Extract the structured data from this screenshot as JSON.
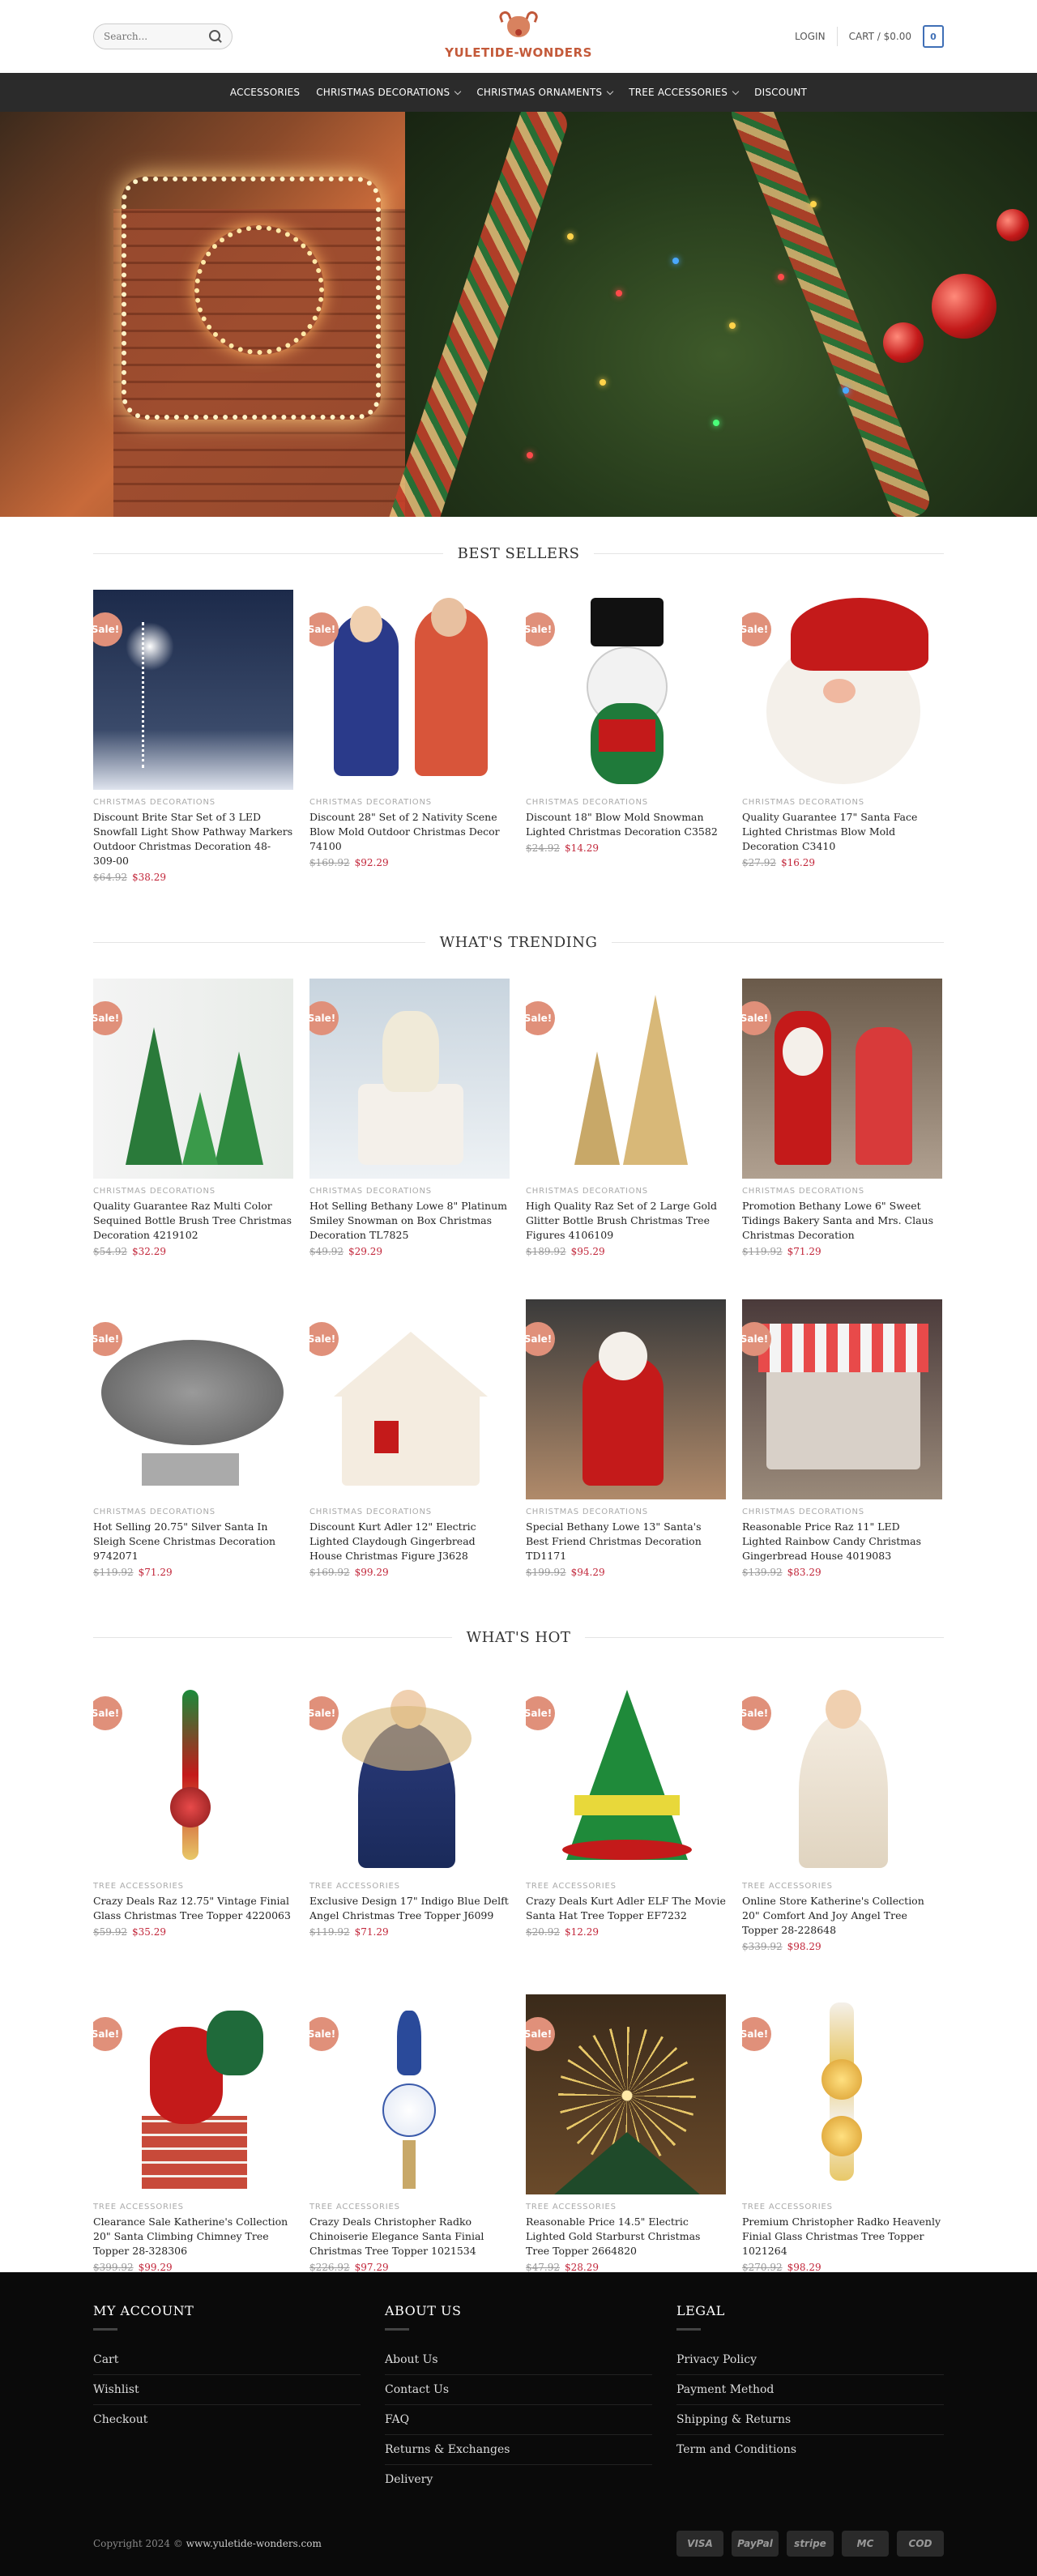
{
  "header": {
    "search_placeholder": "Search...",
    "logo_text": "YULETIDE-WONDERS",
    "login": "LOGIN",
    "cart_label": "CART / $0.00",
    "cart_count": "0"
  },
  "nav": {
    "items": [
      {
        "label": "ACCESSORIES",
        "dropdown": false
      },
      {
        "label": "CHRISTMAS DECORATIONS",
        "dropdown": true
      },
      {
        "label": "CHRISTMAS ORNAMENTS",
        "dropdown": true
      },
      {
        "label": "TREE ACCESSORIES",
        "dropdown": true
      },
      {
        "label": "DISCOUNT",
        "dropdown": false
      }
    ]
  },
  "sale_badge": "Sale!",
  "sections": [
    {
      "title": "BEST SELLERS",
      "products": [
        {
          "category": "CHRISTMAS DECORATIONS",
          "name": "Discount Brite Star Set of 3 LED Snowfall Light Show Pathway Markers Outdoor Christmas Decoration 48-309-00",
          "old": "$64.92",
          "new": "$38.29"
        },
        {
          "category": "CHRISTMAS DECORATIONS",
          "name": "Discount 28\" Set of 2 Nativity Scene Blow Mold Outdoor Christmas Decor 74100",
          "old": "$169.92",
          "new": "$92.29"
        },
        {
          "category": "CHRISTMAS DECORATIONS",
          "name": "Discount 18\" Blow Mold Snowman Lighted Christmas Decoration C3582",
          "old": "$24.92",
          "new": "$14.29"
        },
        {
          "category": "CHRISTMAS DECORATIONS",
          "name": "Quality Guarantee 17\" Santa Face Lighted Christmas Blow Mold Decoration C3410",
          "old": "$27.92",
          "new": "$16.29"
        }
      ]
    },
    {
      "title": "WHAT'S TRENDING",
      "products": [
        {
          "category": "CHRISTMAS DECORATIONS",
          "name": "Quality Guarantee Raz Multi Color Sequined Bottle Brush Tree Christmas Decoration 4219102",
          "old": "$54.92",
          "new": "$32.29"
        },
        {
          "category": "CHRISTMAS DECORATIONS",
          "name": "Hot Selling Bethany Lowe 8\" Platinum Smiley Snowman on Box Christmas Decoration TL7825",
          "old": "$49.92",
          "new": "$29.29"
        },
        {
          "category": "CHRISTMAS DECORATIONS",
          "name": "High Quality Raz Set of 2 Large Gold Glitter Bottle Brush Christmas Tree Figures 4106109",
          "old": "$189.92",
          "new": "$95.29"
        },
        {
          "category": "CHRISTMAS DECORATIONS",
          "name": "Promotion Bethany Lowe 6\" Sweet Tidings Bakery Santa and Mrs. Claus Christmas Decoration",
          "old": "$119.92",
          "new": "$71.29"
        },
        {
          "category": "CHRISTMAS DECORATIONS",
          "name": "Hot Selling 20.75\" Silver Santa In Sleigh Scene Christmas Decoration 9742071",
          "old": "$119.92",
          "new": "$71.29"
        },
        {
          "category": "CHRISTMAS DECORATIONS",
          "name": "Discount Kurt Adler 12\" Electric Lighted Claydough Gingerbread House Christmas Figure J3628",
          "old": "$169.92",
          "new": "$99.29"
        },
        {
          "category": "CHRISTMAS DECORATIONS",
          "name": "Special Bethany Lowe 13\" Santa's Best Friend Christmas Decoration TD1171",
          "old": "$199.92",
          "new": "$94.29"
        },
        {
          "category": "CHRISTMAS DECORATIONS",
          "name": "Reasonable Price Raz 11\" LED Lighted Rainbow Candy Christmas Gingerbread House 4019083",
          "old": "$139.92",
          "new": "$83.29"
        }
      ]
    },
    {
      "title": "WHAT'S HOT",
      "products": [
        {
          "category": "TREE ACCESSORIES",
          "name": "Crazy Deals Raz 12.75\" Vintage Finial Glass Christmas Tree Topper 4220063",
          "old": "$59.92",
          "new": "$35.29"
        },
        {
          "category": "TREE ACCESSORIES",
          "name": "Exclusive Design 17\" Indigo Blue Delft Angel Christmas Tree Topper J6099",
          "old": "$119.92",
          "new": "$71.29"
        },
        {
          "category": "TREE ACCESSORIES",
          "name": "Crazy Deals Kurt Adler ELF The Movie Santa Hat Tree Topper EF7232",
          "old": "$20.92",
          "new": "$12.29"
        },
        {
          "category": "TREE ACCESSORIES",
          "name": "Online Store Katherine's Collection 20\" Comfort And Joy Angel Tree Topper 28-228648",
          "old": "$339.92",
          "new": "$98.29"
        },
        {
          "category": "TREE ACCESSORIES",
          "name": "Clearance Sale Katherine's Collection 20\" Santa Climbing Chimney Tree Topper 28-328306",
          "old": "$399.92",
          "new": "$99.29"
        },
        {
          "category": "TREE ACCESSORIES",
          "name": "Crazy Deals Christopher Radko Chinoiserie Elegance Santa Finial Christmas Tree Topper 1021534",
          "old": "$226.92",
          "new": "$97.29"
        },
        {
          "category": "TREE ACCESSORIES",
          "name": "Reasonable Price 14.5\" Electric Lighted Gold Starburst Christmas Tree Topper 2664820",
          "old": "$47.92",
          "new": "$28.29"
        },
        {
          "category": "TREE ACCESSORIES",
          "name": "Premium Christopher Radko Heavenly Finial Glass Christmas Tree Topper 1021264",
          "old": "$270.92",
          "new": "$98.29"
        }
      ]
    }
  ],
  "footer": {
    "columns": [
      {
        "title": "MY ACCOUNT",
        "links": [
          "Cart",
          "Wishlist",
          "Checkout"
        ]
      },
      {
        "title": "ABOUT US",
        "links": [
          "About Us",
          "Contact Us",
          "FAQ",
          "Returns & Exchanges",
          "Delivery"
        ]
      },
      {
        "title": "LEGAL",
        "links": [
          "Privacy Policy",
          "Payment Method",
          "Shipping & Returns",
          "Term and Conditions"
        ]
      }
    ],
    "copyright": "Copyright 2024 ©",
    "site": "www.yuletide-wonders.com",
    "payments": [
      "VISA",
      "PayPal",
      "stripe",
      "MC",
      "COD"
    ]
  }
}
